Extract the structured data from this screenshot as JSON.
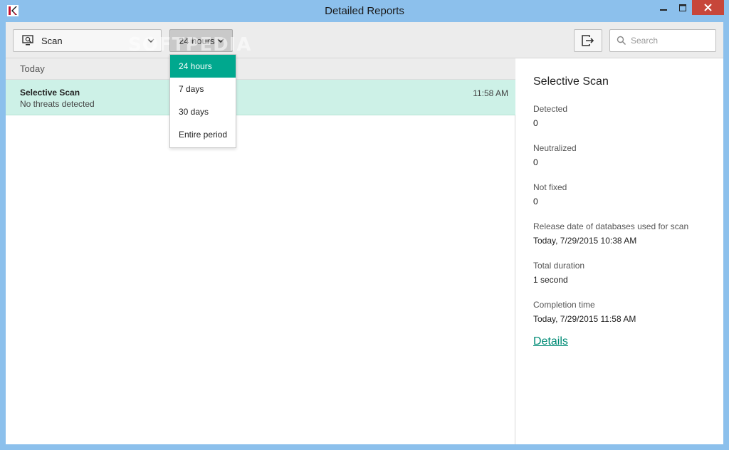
{
  "window": {
    "title": "Detailed Reports"
  },
  "toolbar": {
    "scan_filter_label": "Scan",
    "period_filter_label": "24 hours",
    "search_placeholder": "Search"
  },
  "period_menu": {
    "options": [
      "24 hours",
      "7 days",
      "30 days",
      "Entire period"
    ],
    "selected_index": 0
  },
  "list": {
    "group_header": "Today",
    "rows": [
      {
        "name": "Selective Scan",
        "status": "No threats detected",
        "time": "11:58 AM"
      }
    ]
  },
  "details": {
    "title": "Selective Scan",
    "fields": [
      {
        "label": "Detected",
        "value": "0"
      },
      {
        "label": "Neutralized",
        "value": "0"
      },
      {
        "label": "Not fixed",
        "value": "0"
      },
      {
        "label": "Release date of databases used for scan",
        "value": "Today, 7/29/2015 10:38 AM"
      },
      {
        "label": "Total duration",
        "value": "1 second"
      },
      {
        "label": "Completion time",
        "value": "Today, 7/29/2015 11:58 AM"
      }
    ],
    "link_label": "Details"
  },
  "watermark": "SOFTPEDIA",
  "colors": {
    "titlebar": "#8cc0ec",
    "selection": "#cdf1e7",
    "accent": "#00a88e",
    "link": "#008b76",
    "close": "#c7463a"
  },
  "icons": {
    "app": "kaspersky-logo-icon",
    "scan": "monitor-search-icon",
    "export": "export-icon",
    "search": "search-icon"
  }
}
